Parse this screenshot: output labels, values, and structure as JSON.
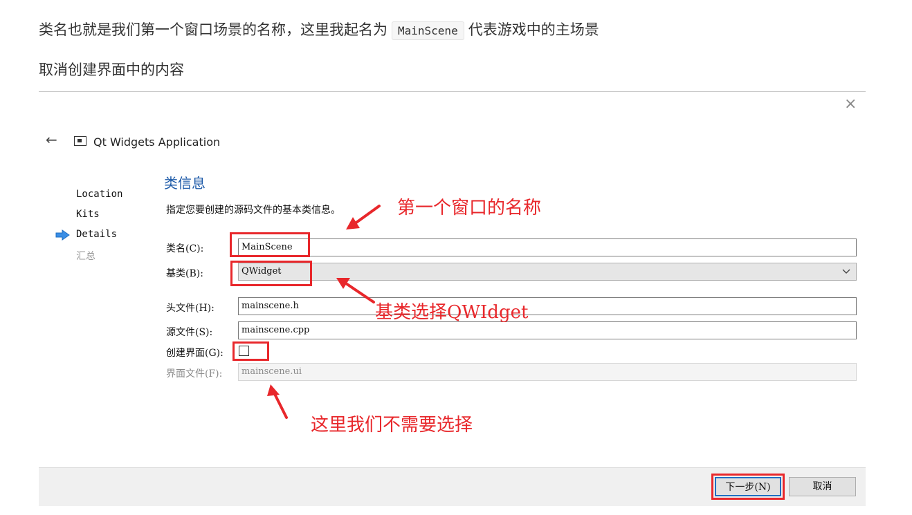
{
  "article": {
    "line1_before": "类名也就是我们第一个窗口场景的名称，这里我起名为",
    "line1_code": "MainScene",
    "line1_after": "代表游戏中的主场景",
    "line2": "取消创建界面中的内容"
  },
  "dialog": {
    "close_glyph": "×",
    "back_glyph": "←",
    "app_title": "Qt Widgets Application",
    "steps": [
      {
        "label": "Location"
      },
      {
        "label": "Kits"
      },
      {
        "label": "Details"
      },
      {
        "label": "汇总"
      }
    ],
    "section_title": "类信息",
    "description": "指定您要创建的源码文件的基本类信息。",
    "fields": {
      "class_name": {
        "label": "类名(C):",
        "value": "MainScene"
      },
      "base_class": {
        "label": "基类(B):",
        "value": "QWidget"
      },
      "header_file": {
        "label": "头文件(H):",
        "value": "mainscene.h"
      },
      "source_file": {
        "label": "源文件(S):",
        "value": "mainscene.cpp"
      },
      "create_form": {
        "label": "创建界面(G):",
        "checked": false
      },
      "form_file": {
        "label": "界面文件(F):",
        "value": "mainscene.ui"
      }
    },
    "buttons": {
      "next": "下一步(N)",
      "cancel": "取消"
    }
  },
  "annotations": {
    "window_name": "第一个窗口的名称",
    "base_class": "基类选择QWIdget",
    "no_need": "这里我们不需要选择"
  },
  "colors": {
    "annotation_red": "#e8272b",
    "section_blue": "#1d5aa8",
    "step_arrow": "#3a8ee6"
  }
}
